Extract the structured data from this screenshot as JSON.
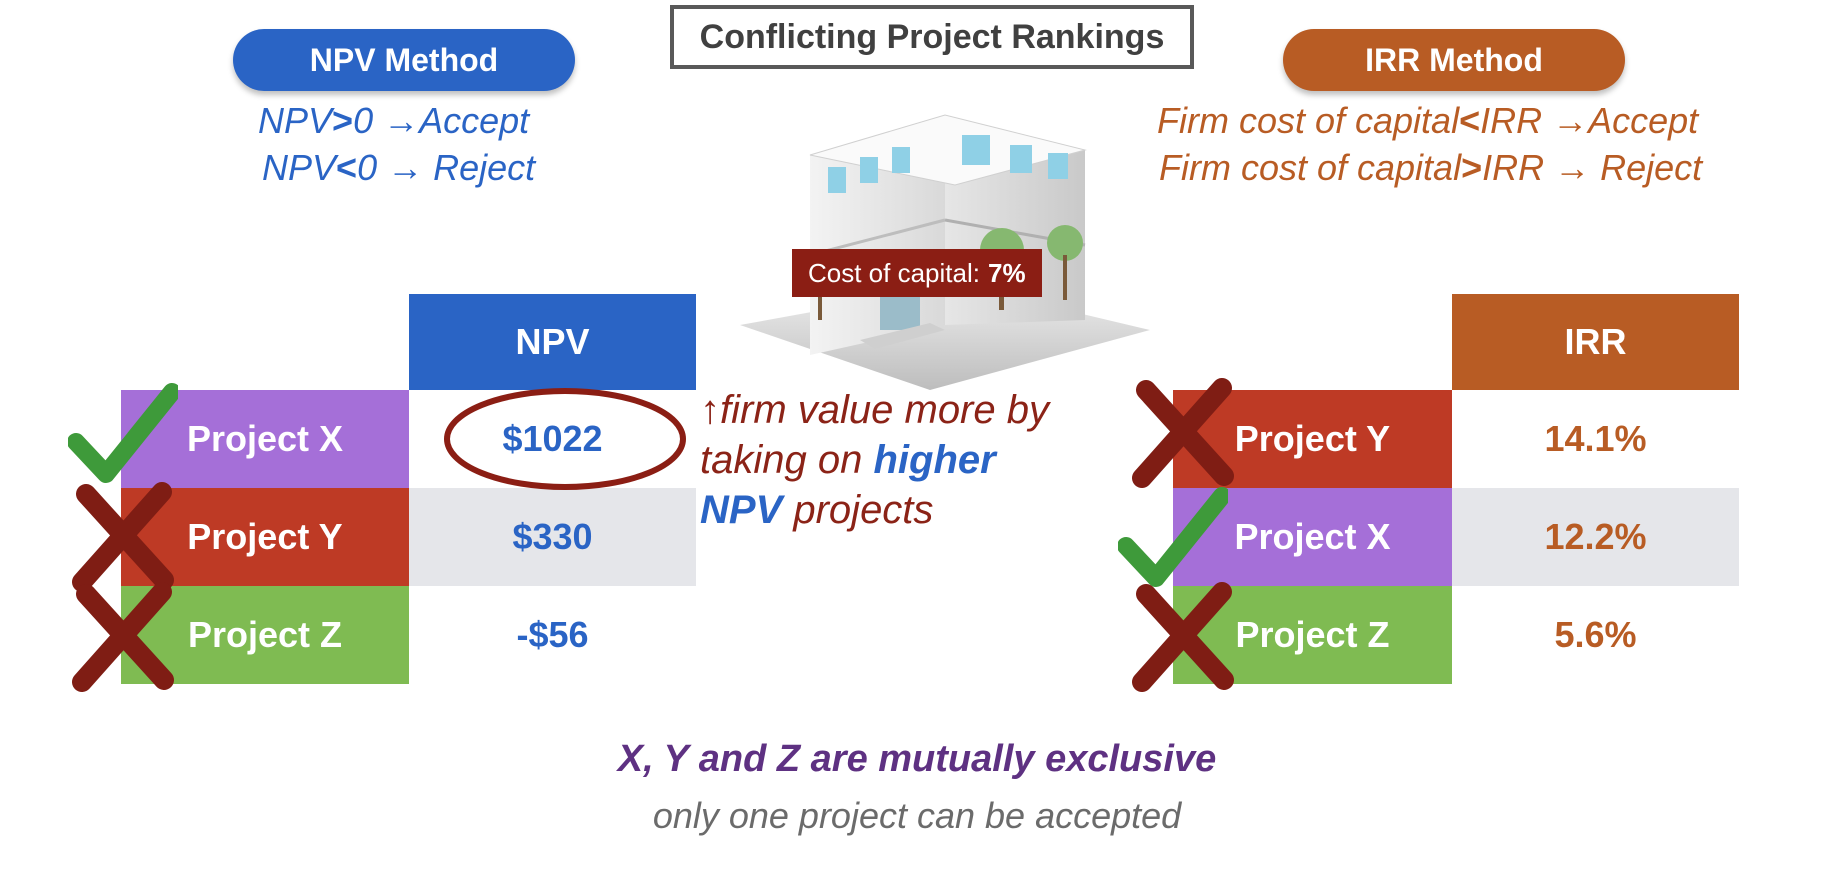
{
  "title": "Conflicting Project Rankings",
  "npv_method": {
    "label": "NPV Method",
    "rule_accept": {
      "a": "NPV",
      "op": ">",
      "b": "0 ",
      "arrow": "→",
      "result": "Accept"
    },
    "rule_reject": {
      "a": "NPV",
      "op": "<",
      "b": "0 ",
      "arrow": "→",
      "result": " Reject"
    }
  },
  "irr_method": {
    "label": "IRR Method",
    "rule_accept": {
      "a": "Firm cost of capital",
      "op": "<",
      "b": "IRR ",
      "arrow": "→",
      "result": "Accept"
    },
    "rule_reject": {
      "a": "Firm cost of capital",
      "op": ">",
      "b": "IRR ",
      "arrow": "→",
      "result": " Reject"
    }
  },
  "cost_of_capital": {
    "label": "Cost of capital:",
    "value": "7%"
  },
  "npv_table": {
    "header": "NPV",
    "rows": [
      {
        "project": "Project X",
        "value": "$1022",
        "mark": "check"
      },
      {
        "project": "Project Y",
        "value": "$330",
        "mark": "cross"
      },
      {
        "project": "Project Z",
        "value": "-$56",
        "mark": "cross"
      }
    ]
  },
  "irr_table": {
    "header": "IRR",
    "rows": [
      {
        "project": "Project Y",
        "value": "14.1%",
        "mark": "cross"
      },
      {
        "project": "Project X",
        "value": "12.2%",
        "mark": "check"
      },
      {
        "project": "Project Z",
        "value": "5.6%",
        "mark": "cross"
      }
    ]
  },
  "middle_note": {
    "arrow": "↑",
    "line1": "firm value more by",
    "line2_a": "taking on ",
    "line2_b": "higher",
    "line3_a": "NPV",
    "line3_b": " projects"
  },
  "footer": {
    "line1": "X, Y and Z are mutually exclusive",
    "line2": "only one project can be accepted"
  },
  "colors": {
    "npv_blue": "#2a64c5",
    "irr_orange": "#b85c24",
    "project_x": "#a56fd8",
    "project_y": "#be3a25",
    "project_z": "#7fbb52",
    "check": "#3e9a3a",
    "cross": "#7f1d14"
  },
  "icons": [
    "building-icon",
    "check-icon",
    "cross-icon"
  ]
}
